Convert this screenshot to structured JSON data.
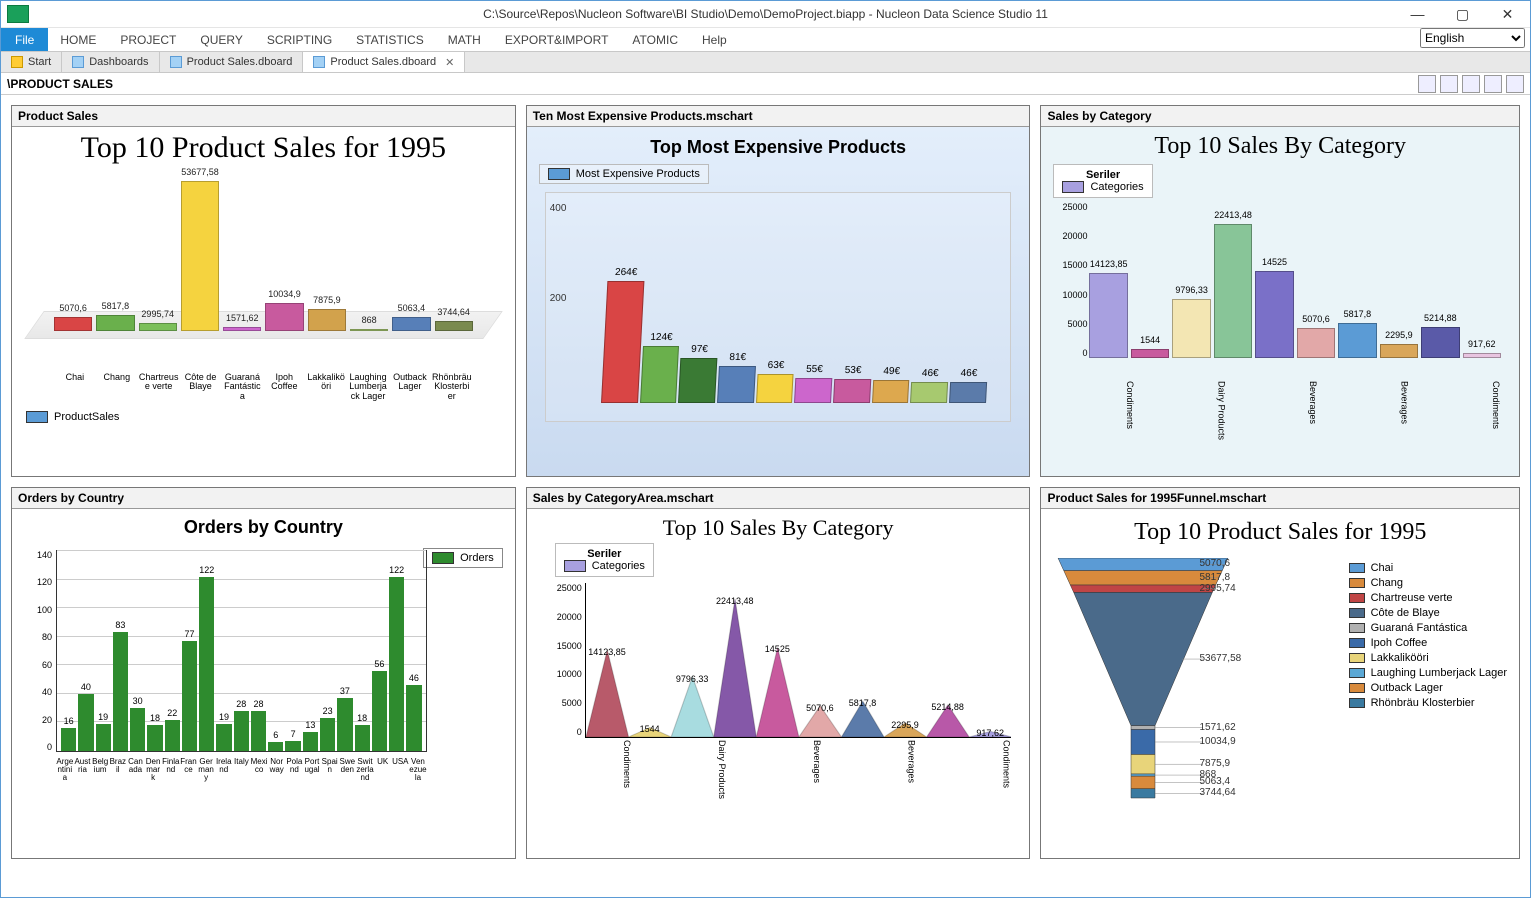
{
  "window": {
    "title": "C:\\Source\\Repos\\Nucleon Software\\BI Studio\\Demo\\DemoProject.biapp - Nucleon Data Science Studio 11",
    "language": "English"
  },
  "menu": {
    "file": "File",
    "items": [
      "HOME",
      "PROJECT",
      "QUERY",
      "SCRIPTING",
      "STATISTICS",
      "MATH",
      "EXPORT&IMPORT",
      "ATOMIC",
      "Help"
    ]
  },
  "tabs": [
    {
      "label": "Start",
      "icon": "star"
    },
    {
      "label": "Dashboards",
      "icon": "dash"
    },
    {
      "label": "Product Sales.dboard",
      "icon": "dash"
    },
    {
      "label": "Product Sales.dboard",
      "icon": "dash",
      "active": true,
      "closable": true
    }
  ],
  "breadcrumb": "\\PRODUCT SALES",
  "panels": {
    "p1": {
      "header": "Product Sales"
    },
    "p2": {
      "header": "Ten Most Expensive Products.mschart"
    },
    "p3": {
      "header": "Sales by Category"
    },
    "p4": {
      "header": "Orders by Country"
    },
    "p5": {
      "header": "Sales by CategoryArea.mschart"
    },
    "p6": {
      "header": "Product Sales for 1995Funnel.mschart"
    }
  },
  "chart_data": [
    {
      "id": "product_sales_1995",
      "type": "bar",
      "title": "Top 10 Product Sales for 1995",
      "legend": "ProductSales",
      "categories": [
        "Chai",
        "Chang",
        "Chartreuse verte",
        "Côte de Blaye",
        "Guaraná Fantástica",
        "Ipoh Coffee",
        "Lakkalikööri",
        "Laughing Lumberjack Lager",
        "Outback Lager",
        "Rhönbräu Klosterbier"
      ],
      "values": [
        5070.6,
        5817.8,
        2995.74,
        53677.58,
        1571.62,
        10034.9,
        7875.9,
        868,
        5063.4,
        3744.64
      ],
      "value_labels": [
        "5070,6",
        "5817,8",
        "2995,74",
        "53677,58",
        "1571,62",
        "10034,9",
        "7875,9",
        "868",
        "5063,4",
        "3744,64"
      ],
      "colors": [
        "#d94545",
        "#6ab04c",
        "#7bbf5a",
        "#f5d33f",
        "#cc66cc",
        "#c85a9e",
        "#d2a24c",
        "#a7c96f",
        "#577fb8",
        "#7a8a4f"
      ]
    },
    {
      "id": "most_expensive",
      "type": "bar",
      "title": "Top Most Expensive Products",
      "legend": "Most Expensive Products",
      "values": [
        264,
        124,
        97,
        81,
        63,
        55,
        53,
        49,
        46,
        46
      ],
      "value_labels": [
        "264€",
        "124€",
        "97€",
        "81€",
        "63€",
        "55€",
        "53€",
        "49€",
        "46€",
        "46€"
      ],
      "yticks": [
        "200",
        "400"
      ],
      "colors": [
        "#d94545",
        "#6ab04c",
        "#3a7a34",
        "#577fb8",
        "#f5d33f",
        "#cc66cc",
        "#c85a9e",
        "#dda84e",
        "#a7c96f",
        "#5b7baa"
      ]
    },
    {
      "id": "sales_by_category_bar",
      "type": "bar",
      "title": "Top 10 Sales By Category",
      "legend_title": "Seriler",
      "legend": "Categories",
      "categories": [
        "Condiments",
        "",
        "Dairy Products",
        "",
        "Beverages",
        "",
        "Beverages",
        "",
        "Condiments"
      ],
      "values": [
        14123.85,
        1544,
        9796.33,
        22413.48,
        14525,
        5070.6,
        5817.8,
        2295.9,
        5214.88,
        917.62
      ],
      "value_labels": [
        "14123,85",
        "1544",
        "9796,33",
        "22413,48",
        "14525",
        "5070,6",
        "5817,8",
        "2295,9",
        "5214,88",
        "917,62"
      ],
      "yticks": [
        "0",
        "5000",
        "10000",
        "15000",
        "20000",
        "25000"
      ],
      "colors": [
        "#a8a0e0",
        "#c85a9e",
        "#f3e6b3",
        "#88c598",
        "#7a70c8",
        "#e2a8a8",
        "#5b9bd5",
        "#d9a65a",
        "#5a5aa8",
        "#e8c4e0"
      ]
    },
    {
      "id": "orders_by_country",
      "type": "bar",
      "title": "Orders by Country",
      "legend": "Orders",
      "categories": [
        "Argentinia",
        "Austria",
        "Belgium",
        "Brazil",
        "Canada",
        "Denmark",
        "Finland",
        "France",
        "Germany",
        "Ireland",
        "Italy",
        "Mexico",
        "Norway",
        "Poland",
        "Portugal",
        "Spain",
        "Sweden",
        "Switzerland",
        "UK",
        "USA",
        "Venezuela"
      ],
      "values": [
        16,
        40,
        19,
        83,
        30,
        18,
        22,
        77,
        122,
        19,
        28,
        28,
        6,
        7,
        13,
        23,
        37,
        18,
        56,
        122,
        46
      ],
      "yticks": [
        "0",
        "20",
        "40",
        "60",
        "80",
        "100",
        "120",
        "140"
      ],
      "ylim": [
        0,
        140
      ]
    },
    {
      "id": "sales_by_category_area",
      "type": "area",
      "title": "Top 10 Sales By Category",
      "legend_title": "Seriler",
      "legend": "Categories",
      "categories": [
        "Condiments",
        "",
        "Dairy Products",
        "",
        "Beverages",
        "",
        "Beverages",
        "",
        "Condiments"
      ],
      "values": [
        14123.85,
        1544,
        9796.33,
        22413.48,
        14525,
        5070.6,
        5817.8,
        2295.9,
        5214.88,
        917.62
      ],
      "value_labels": [
        "14123,85",
        "1544",
        "9796,33",
        "22413,48",
        "14525",
        "5070,6",
        "5817,8",
        "2295,9",
        "5214,88",
        "917,62"
      ],
      "yticks": [
        "0",
        "5000",
        "10000",
        "15000",
        "20000",
        "25000"
      ],
      "colors": [
        "#b85a6a",
        "#e8d47a",
        "#a8dce0",
        "#8558a8",
        "#c85a9e",
        "#e2a8a8",
        "#5b7baa",
        "#d9a65a",
        "#b858a8",
        "#a8a0e0"
      ]
    },
    {
      "id": "product_sales_funnel",
      "type": "funnel",
      "title": "Top 10 Product Sales for 1995",
      "series": [
        {
          "name": "Chai",
          "value": 5070.6,
          "label": "5070,6",
          "color": "#5b9bd5"
        },
        {
          "name": "Chang",
          "value": 5817.8,
          "label": "5817,8",
          "color": "#d88a3c"
        },
        {
          "name": "Chartreuse verte",
          "value": 2995.74,
          "label": "2995,74",
          "color": "#c04545"
        },
        {
          "name": "Côte de Blaye",
          "value": 53677.58,
          "label": "53677,58",
          "color": "#4a6a8a"
        },
        {
          "name": "Guaraná Fantástica",
          "value": 1571.62,
          "label": "1571,62",
          "color": "#b0b0b0"
        },
        {
          "name": "Ipoh Coffee",
          "value": 10034.9,
          "label": "10034,9",
          "color": "#3a6aa8"
        },
        {
          "name": "Lakkalikööri",
          "value": 7875.9,
          "label": "7875,9",
          "color": "#e8d47a"
        },
        {
          "name": "Laughing Lumberjack Lager",
          "value": 868,
          "label": "868",
          "color": "#5ba8d5"
        },
        {
          "name": "Outback Lager",
          "value": 5063.4,
          "label": "5063,4",
          "color": "#d88a3c"
        },
        {
          "name": "Rhönbräu Klosterbier",
          "value": 3744.64,
          "label": "3744,64",
          "color": "#3a7aa0"
        }
      ]
    }
  ]
}
